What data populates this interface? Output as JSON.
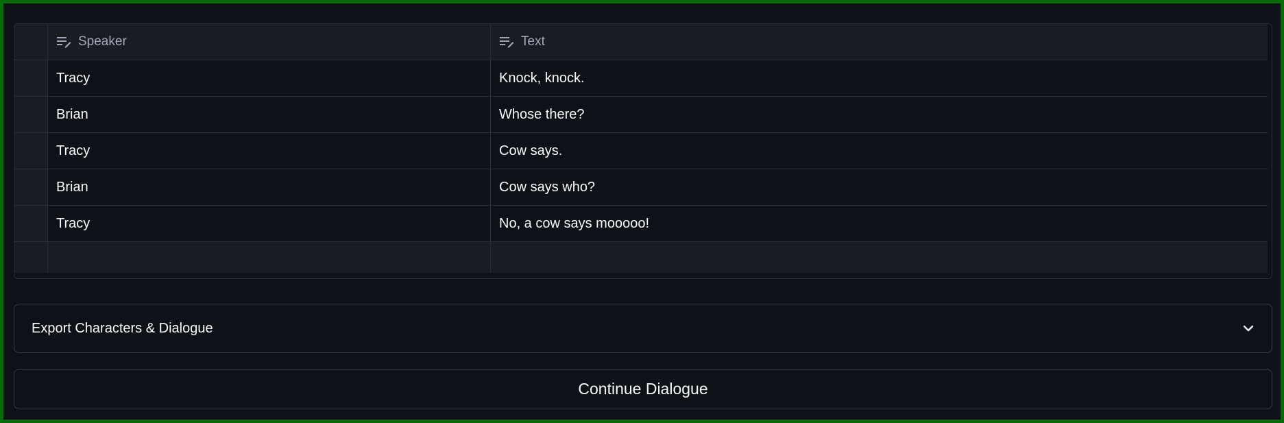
{
  "table": {
    "columns": [
      {
        "label": "Speaker",
        "icon": "text-column-icon"
      },
      {
        "label": "Text",
        "icon": "text-column-icon"
      }
    ],
    "rows": [
      {
        "speaker": "Tracy",
        "text": "Knock, knock."
      },
      {
        "speaker": "Brian",
        "text": "Whose there?"
      },
      {
        "speaker": "Tracy",
        "text": "Cow says."
      },
      {
        "speaker": "Brian",
        "text": "Cow says who?"
      },
      {
        "speaker": "Tracy",
        "text": "No, a cow says mooooo!"
      }
    ]
  },
  "expander": {
    "label": "Export Characters & Dialogue",
    "icon": "chevron-down-icon"
  },
  "continue_button": {
    "label": "Continue Dialogue"
  },
  "colors": {
    "background": "#0e1117",
    "frame": "#0b6b0b",
    "header": "#1a1c24"
  }
}
